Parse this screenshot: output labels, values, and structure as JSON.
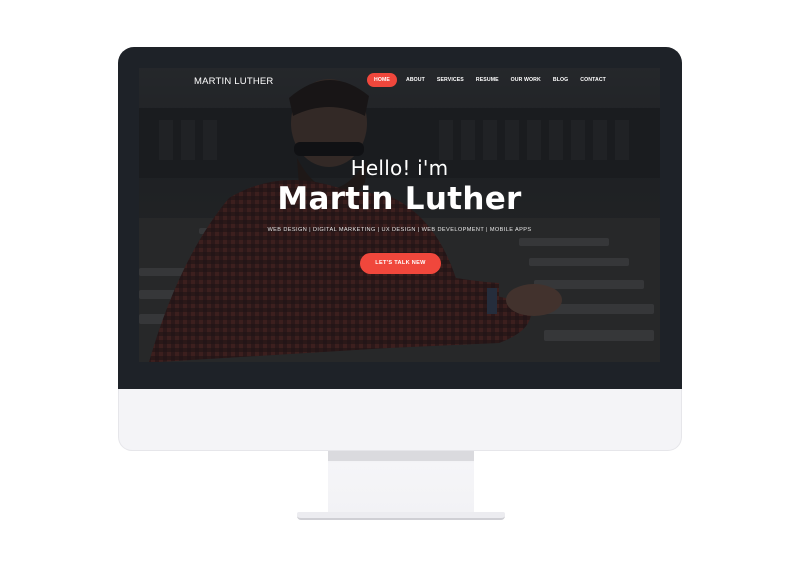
{
  "site": {
    "brand": "MARTIN LUTHER",
    "nav": [
      {
        "label": "HOME",
        "active": true
      },
      {
        "label": "ABOUT",
        "active": false
      },
      {
        "label": "SERVICES",
        "active": false
      },
      {
        "label": "RESUME",
        "active": false
      },
      {
        "label": "OUR WORK",
        "active": false
      },
      {
        "label": "BLOG",
        "active": false
      },
      {
        "label": "CONTACT",
        "active": false
      }
    ],
    "hero": {
      "greeting": "Hello! i'm",
      "name": "Martin Luther",
      "tagline": "WEB DESIGN | DIGITAL MARKETING | UX DESIGN | WEB DEVELOPMENT | MOBILE APPS",
      "cta_label": "LET'S TALK NEW"
    }
  },
  "colors": {
    "accent": "#f0473c",
    "bezel": "#1e2228",
    "chin": "#f4f4f7"
  }
}
